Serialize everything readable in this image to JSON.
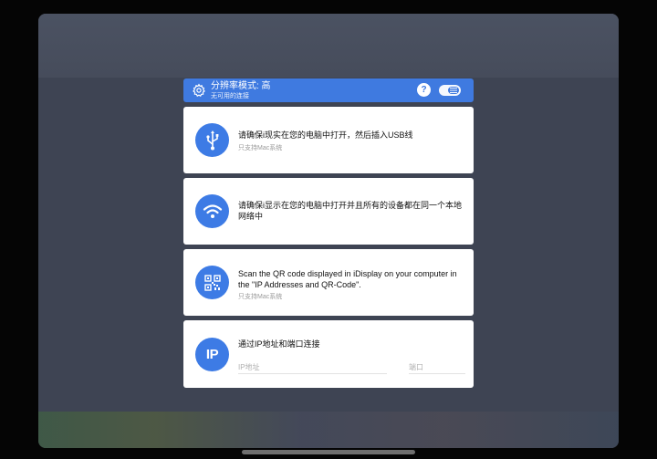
{
  "header": {
    "title": "分辨率模式: 高",
    "subtitle": "无可用的连接",
    "help_label": "?"
  },
  "cards": {
    "usb": {
      "title": "请确保i现实在您的电脑中打开，然后插入USB线",
      "note": "只支持Mac系统"
    },
    "wifi": {
      "title": "请确保i显示在您的电脑中打开并且所有的设备都在同一个本地网络中"
    },
    "qr": {
      "title": "Scan the QR code displayed in iDisplay on your computer in the \"IP Addresses and QR-Code\".",
      "note": "只支持Mac系统"
    },
    "ip": {
      "title": "通过IP地址和端口连接",
      "icon_text": "IP",
      "ip_placeholder": "IP地址",
      "port_placeholder": "端口"
    }
  },
  "colors": {
    "accent": "#3f7ae0",
    "icon_bg": "#3d7be5"
  }
}
